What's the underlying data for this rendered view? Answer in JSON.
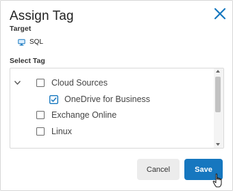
{
  "dialog": {
    "title": "Assign Tag"
  },
  "target": {
    "section_label": "Target",
    "value": "SQL"
  },
  "select_tag": {
    "section_label": "Select Tag",
    "tree": [
      {
        "label": "Cloud Sources",
        "checked": false,
        "expanded": true
      },
      {
        "label": "OneDrive for Business",
        "checked": true
      },
      {
        "label": "Exchange Online",
        "checked": false
      },
      {
        "label": "Linux",
        "checked": false
      }
    ]
  },
  "actions": {
    "cancel_label": "Cancel",
    "save_label": "Save"
  },
  "colors": {
    "accent": "#1677bf",
    "cancel_bg": "#ececec"
  },
  "icons": {
    "close": "close-icon",
    "target": "monitor-icon",
    "expand": "chevron-down-icon",
    "checked": "check-icon",
    "cursor": "hand-pointer-icon"
  }
}
